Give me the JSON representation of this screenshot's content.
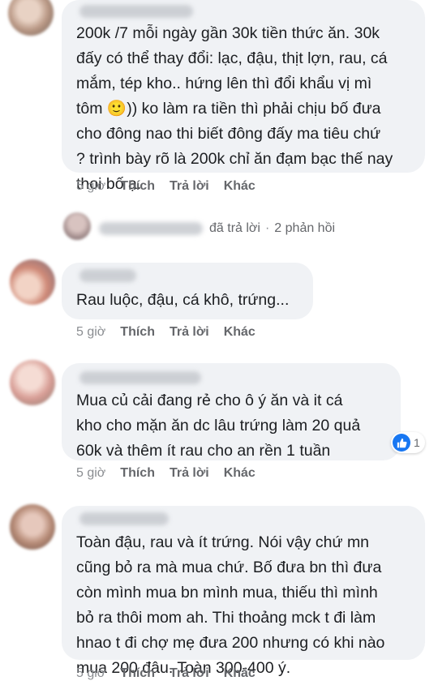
{
  "comments": [
    {
      "text": "200k /7 mỗi ngày gần 30k tiền thức ăn. 30k\nđấy có thể thay đổi: lạc, đậu, thịt lợn, rau, cá\nmắm, tép kho.. hứng lên thì đổi khẩu vị mì\ntôm 🙂)) ko làm ra tiền thì phải chịu bố đưa\ncho đông nao thi biết đông đấy ma tiêu chứ\n? trình bày rõ là 200k chỉ ăn đạm bạc thế nay\nthoi bố ạ.",
      "time": "5 giờ",
      "like": "Thích",
      "reply": "Trả lời",
      "more": "Khác"
    },
    {
      "text": "Rau luộc, đậu, cá khô, trứng...",
      "time": "5 giờ",
      "like": "Thích",
      "reply": "Trả lời",
      "more": "Khác"
    },
    {
      "text": "Mua củ cải đang rẻ cho ô ý ăn và it cá\nkho cho mặn ăn dc lâu trứng làm 20 quả\n60k và thêm ít rau cho an rền 1 tuần",
      "time": "5 giờ",
      "like": "Thích",
      "reply": "Trả lời",
      "more": "Khác",
      "reaction_count": "1"
    },
    {
      "text": "Toàn đậu, rau và ít trứng. Nói vậy chứ mn\ncũng bỏ ra mà mua chứ. Bố đưa bn thì đưa\ncòn mình mua bn mình mua, thiếu thì mình\nbỏ ra thôi mom ah. Thi thoảng mck t đi làm\nhnao t đi chợ mẹ đưa 200 nhưng có khi nào\nmua 200 đâu. Toàn 300-400 ý.",
      "time": "5 giờ",
      "like": "Thích",
      "reply": "Trả lời",
      "more": "Khác"
    }
  ],
  "replies_summary": {
    "action": "đã trả lời",
    "count": "2 phản hồi"
  },
  "colors": {
    "bubble": "#f0f2f5",
    "meta": "#65676b",
    "like_blue": "#1877f2"
  }
}
